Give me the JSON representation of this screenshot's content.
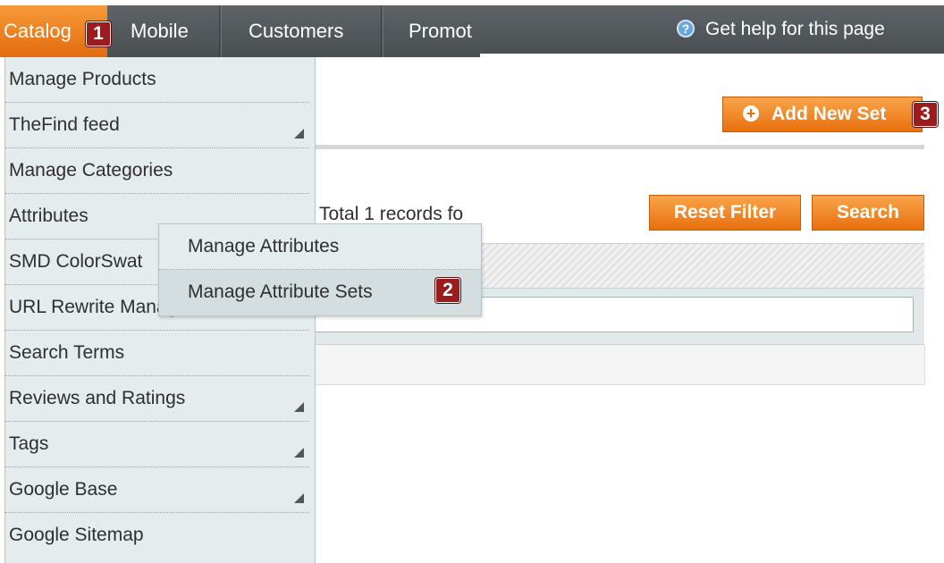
{
  "nav": {
    "items": [
      {
        "label": "Catalog"
      },
      {
        "label": "Mobile"
      },
      {
        "label": "Customers"
      },
      {
        "label": "Promot"
      }
    ],
    "help_label": "Get help for this page",
    "help_icon": "question-icon"
  },
  "badges": {
    "one": "1",
    "two": "2",
    "three": "3"
  },
  "dropdown": {
    "items": [
      {
        "label": "Manage Products",
        "has_submenu": false
      },
      {
        "label": "TheFind feed",
        "has_submenu": true
      },
      {
        "label": "Manage Categories",
        "has_submenu": false
      },
      {
        "label": "Attributes",
        "has_submenu": true
      },
      {
        "label": "SMD ColorSwat",
        "has_submenu": false
      },
      {
        "label": "URL Rewrite Management",
        "has_submenu": false
      },
      {
        "label": "Search Terms",
        "has_submenu": false
      },
      {
        "label": "Reviews and Ratings",
        "has_submenu": true
      },
      {
        "label": "Tags",
        "has_submenu": true
      },
      {
        "label": "Google Base",
        "has_submenu": true
      },
      {
        "label": "Google Sitemap",
        "has_submenu": false
      }
    ]
  },
  "submenu": {
    "items": [
      {
        "label": "Manage Attributes"
      },
      {
        "label": "Manage Attribute Sets"
      }
    ]
  },
  "main": {
    "add_button_label": "Add New Set",
    "records_text": "Total 1 records fo",
    "reset_filter_label": "Reset Filter",
    "search_label": "Search",
    "filter_value": ""
  },
  "colors": {
    "accent": "#e8700e",
    "nav_bg": "#4f5457",
    "menu_bg": "#e4ecee",
    "badge": "#9b1c1c"
  }
}
